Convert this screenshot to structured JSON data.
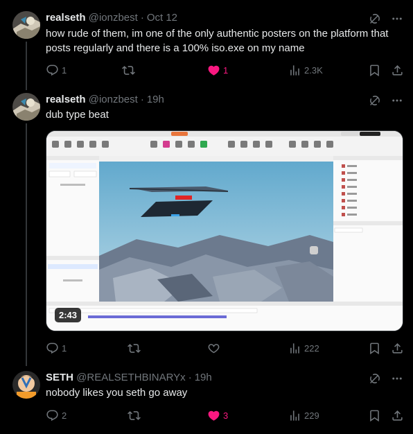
{
  "tweets": [
    {
      "name": "realseth",
      "handle": "@ionzbest",
      "time": "Oct 12",
      "text": "how rude of them, im one of the only authentic posters on the platform that posts regularly and there is a 100% iso.exe on my name",
      "replies": "1",
      "retweets": "",
      "likes": "1",
      "views": "2.3K",
      "liked": true
    },
    {
      "name": "realseth",
      "handle": "@ionzbest",
      "time": "19h",
      "text": "dub type beat",
      "video_duration": "2:43",
      "replies": "1",
      "retweets": "",
      "likes": "",
      "views": "222",
      "liked": false
    },
    {
      "name": "SETH",
      "handle": "@REALSETHBINARYx",
      "time": "19h",
      "text": "nobody likes you seth go away",
      "replies": "2",
      "retweets": "",
      "likes": "3",
      "views": "229",
      "liked": true
    }
  ],
  "colors": {
    "background": "#000000",
    "text": "#e7e9ea",
    "muted": "#71767b",
    "like_active": "#f91880"
  },
  "icons": [
    "grok-icon",
    "more-icon",
    "reply-icon",
    "retweet-icon",
    "like-icon",
    "views-icon",
    "bookmark-icon",
    "share-icon"
  ]
}
